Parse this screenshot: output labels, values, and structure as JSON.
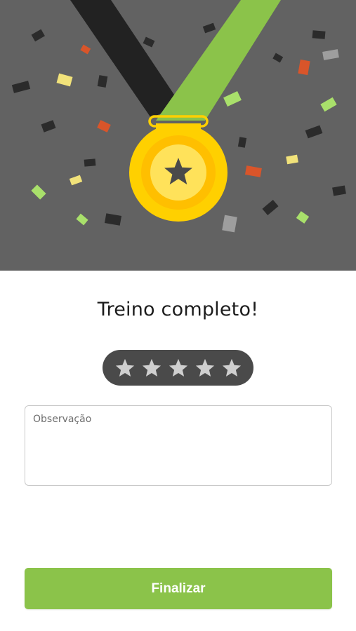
{
  "hero": {
    "illustration": "medal-with-confetti",
    "background_color": "#626262",
    "ribbon_dark_color": "#222222",
    "ribbon_green_color": "#8bc34a",
    "medal_color": "#ffd000",
    "confetti_colors": [
      "#2b2b2b",
      "#f1e27a",
      "#d9552a",
      "#a9e06b",
      "#9e9e9e"
    ]
  },
  "title": "Treino completo!",
  "rating": {
    "max": 5,
    "value": 0,
    "star_icon": "star-icon",
    "pill_color": "#4a4a4a",
    "star_color": "#cfcfcf"
  },
  "observation": {
    "placeholder": "Observação",
    "value": ""
  },
  "finish_button": {
    "label": "Finalizar",
    "color": "#8bc34a"
  }
}
